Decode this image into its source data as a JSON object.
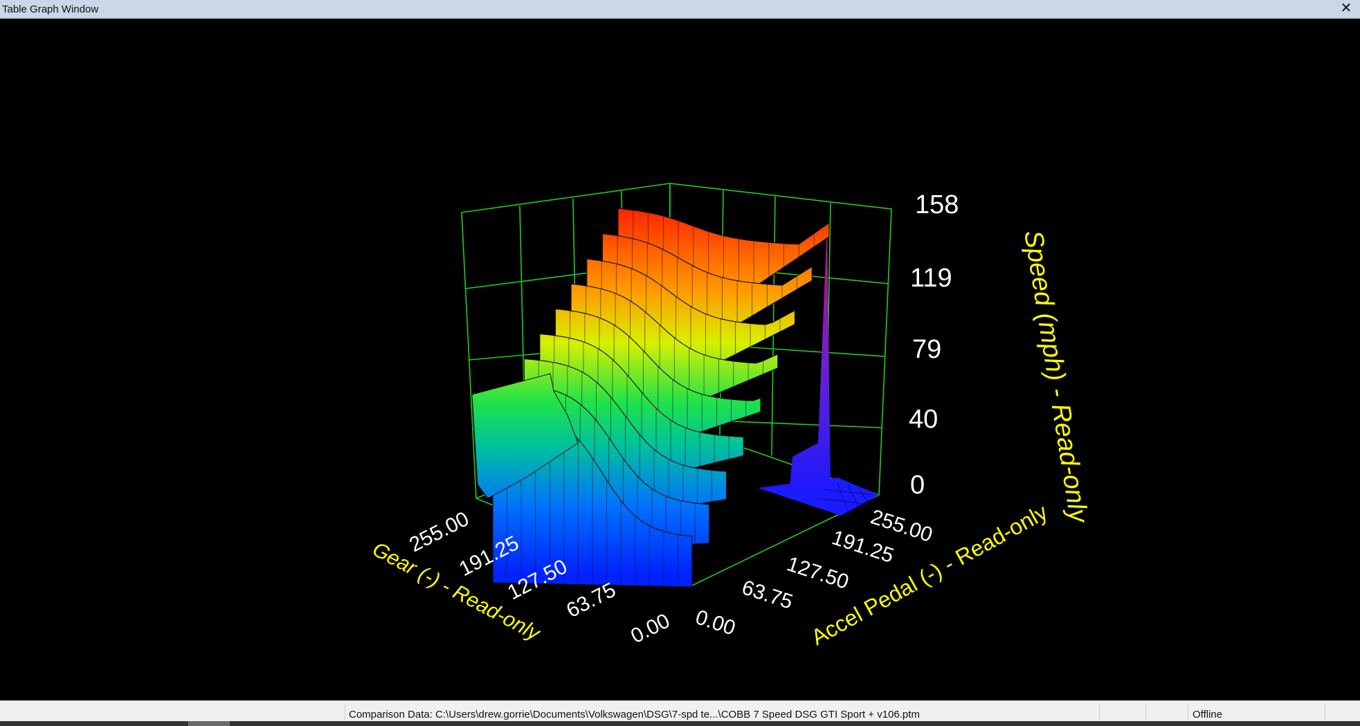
{
  "window": {
    "title": "Table Graph Window",
    "close_icon": "close-icon"
  },
  "graph": {
    "surface_coloring": "rainbow height map (blue low, red high)",
    "colors": {
      "background": "#000000",
      "grid": "#22cc22",
      "axis_title": "#ffff00",
      "tick_label": "#ffffff"
    },
    "z_axis": {
      "title": "Speed (mph) - Read-only",
      "ticks": [
        "158",
        "119",
        "79",
        "40",
        "0"
      ]
    },
    "gear_axis": {
      "title": "Gear (-) - Read-only",
      "ticks": [
        "255.00",
        "191.25",
        "127.50",
        "63.75",
        "0.00"
      ]
    },
    "pedal_axis": {
      "title": "Accel Pedal (-) - Read-only",
      "ticks": [
        "0.00",
        "63.75",
        "127.50",
        "191.25",
        "255.00"
      ]
    }
  },
  "status_bar": {
    "comparison": "Comparison Data: C:\\Users\\drew.gorrie\\Documents\\Volkswagen\\DSG\\7-spd te...\\COBB 7 Speed DSG GTI Sport + v106.ptm",
    "connection": "Offline"
  }
}
